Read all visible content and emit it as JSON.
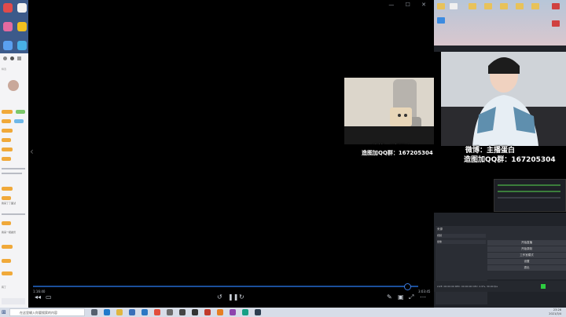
{
  "player": {
    "time_current": "1:16:40",
    "time_total": "3:03:45",
    "progress": 0.97,
    "window_controls": "— ☐ ✕",
    "prev_arrow": "‹"
  },
  "overlay": {
    "line1": "微博：主播蛋白",
    "line2": "造图加QQ群：167205304"
  },
  "obs": {
    "scene_header": "来源",
    "source_row": "视频",
    "source_row2": "摄像",
    "controls": [
      "开始直播",
      "开始录制",
      "工作室模式",
      "设置",
      "退出"
    ],
    "status": "LIVE: 00:00:00   REC: 00:00:00   CPU: 2.9%, 30.00 fps",
    "volume_badge": "22"
  },
  "left_strip": {
    "chat_snippets": [
      "精选",
      "我来了了面试",
      "我来一把魔兽",
      "有了"
    ]
  },
  "taskbar": {
    "search_placeholder": "在这里输入你要搜索的内容",
    "time": "23:26",
    "date": "2021/3/4",
    "icons": [
      "start-icon",
      "task-view-icon",
      "edge-icon",
      "explorer-icon",
      "store-icon",
      "mail-icon",
      "chrome-icon",
      "settings-icon",
      "media-icon",
      "obs-icon",
      "player-icon",
      "pinned-app-icon"
    ]
  },
  "colors": {
    "accent": "#3d7be0",
    "player_bg": "#000000",
    "taskbar": "#d7dde8"
  }
}
